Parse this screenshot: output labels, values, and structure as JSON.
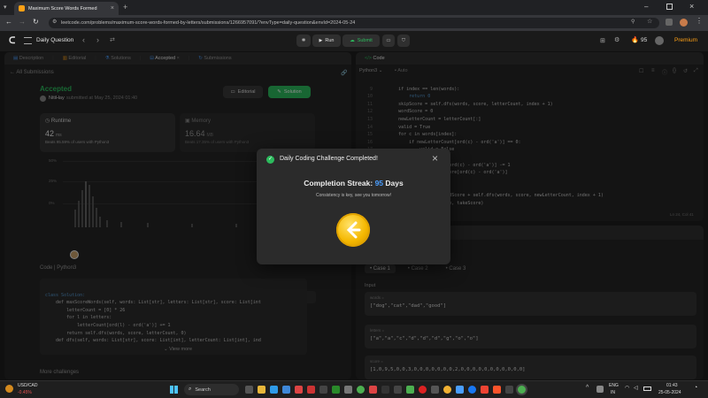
{
  "browser": {
    "tab_title": "Maximum Score Words Formed",
    "url": "leetcode.com/problems/maximum-score-words-formed-by-letters/submissions/1266957091/?envType=daily-question&envId=2024-05-24"
  },
  "nav": {
    "problem_list": "Daily Question",
    "run_label": "Run",
    "submit_label": "Submit",
    "streak_count": "95",
    "premium_label": "Premium"
  },
  "left_panel": {
    "tabs": [
      "Description",
      "Editorial",
      "Solutions",
      "Accepted",
      "Submissions"
    ],
    "all_submissions": "All Submissions",
    "status": "Accepted",
    "submitter": "NitiHay",
    "submitted_at": "submitted at May 25, 2024 01:40",
    "editorial_btn": "Editorial",
    "solution_btn": "Solution",
    "runtime_label": "Runtime",
    "runtime_value": "42",
    "runtime_unit": "ms",
    "runtime_beats": "Beats 95.59% of users with Python3",
    "memory_label": "Memory",
    "memory_value": "16.64",
    "memory_unit": "MB",
    "memory_beats": "Beats 17.35% of users with Python3",
    "chart_yticks": [
      "50%",
      "25%",
      "0%"
    ],
    "chart_xticks": [
      "34ms",
      "78ms",
      "123ms",
      "168ms"
    ],
    "chart_xticks_bottom": [
      "34ms",
      "78ms",
      "123ms",
      "168ms"
    ],
    "code_header": "Code | Python3",
    "code_lines": [
      "class Solution:",
      "    def maxScoreWords(self, words: List[str], letters: List[str], score: List[int",
      "        letterCount = [0] * 26",
      "        for l in letters:",
      "            letterCount[ord(l) - ord('a')] += 1",
      "        return self.dfs(words, score, letterCount, 0)",
      "",
      "    def dfs(self, words: List[str], score: List[int], letterCount: List[int], ind"
    ],
    "view_more": "View more",
    "more_challenges": "More challenges"
  },
  "right_panel": {
    "code_tab": "Code",
    "language": "Python3",
    "auto_label": "Auto",
    "line_numbers": [
      "9",
      "10",
      "11",
      "12",
      "13",
      "14",
      "15",
      "16",
      "17",
      "18",
      "19",
      "20",
      "21",
      "22",
      "23",
      "24",
      "25"
    ],
    "code_lines": [
      "        if index == len(words):",
      "            return 0",
      "        skipScore = self.dfs(words, score, letterCount, index + 1)",
      "        wordScore = 0",
      "        newLetterCount = letterCount[:]",
      "        valid = True",
      "        for c in words[index]:",
      "            if newLetterCount[ord(c) - ord('a')] == 0:",
      "                valid = False",
      "                break",
      "            newLetterCount[ord(c) - ord('a')] -= 1",
      "            wordScore += score[ord(c) - ord('a')]",
      "        takeScore = 0",
      "        if valid:",
      "            takeScore = wordScore + self.dfs(words, score, newLetterCount, index + 1)",
      "        return max(skipScore, takeScore)",
      ""
    ],
    "cursor_pos": "Ln 24, Col 41",
    "cases": [
      "Case 1",
      "Case 2",
      "Case 3"
    ],
    "input_label": "Input",
    "words_label": "words =",
    "words_value": "[\"dog\",\"cat\",\"dad\",\"good\"]",
    "letters_label": "letters =",
    "letters_value": "[\"a\",\"a\",\"c\",\"d\",\"d\",\"d\",\"g\",\"o\",\"o\"]",
    "score_label": "score =",
    "score_value": "[1,0,9,5,0,0,3,0,0,0,0,0,0,0,2,0,0,0,0,0,0,0,0,0,0,0]"
  },
  "modal": {
    "title": "Daily Coding Challenge Completed!",
    "streak_prefix": "Completion Streak:",
    "streak_number": "95",
    "streak_suffix": "Days",
    "subtitle": "Consistency is key, see you tomorrow!"
  },
  "taskbar": {
    "ticker_name": "USD/CAD",
    "ticker_change": "-0.45%",
    "search_placeholder": "Search",
    "lang_top": "ENG",
    "lang_bottom": "IN",
    "time": "01:43",
    "date": "25-05-2024"
  },
  "colors": {
    "accepted": "#2cbb5d",
    "streak_blue": "#4a9eff",
    "gold": "#f5b800",
    "premium": "#ffa116"
  }
}
